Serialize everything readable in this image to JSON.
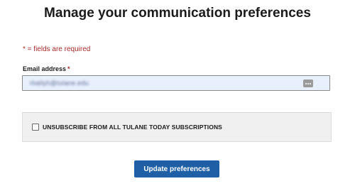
{
  "page": {
    "title": "Manage your communication preferences"
  },
  "form": {
    "required_note": "* = fields are required",
    "email": {
      "label": "Email address",
      "required_marker": "*",
      "value": "rballyh@tulane.edu",
      "value_obscured": true
    },
    "unsubscribe": {
      "label": "UNSUBSCRIBE FROM ALL TULANE TODAY SUBSCRIPTIONS",
      "checked": false
    },
    "submit_label": "Update preferences"
  },
  "colors": {
    "accent": "#1f5fa6",
    "required": "#a52a2a",
    "input_bg": "#e8f0fe",
    "panel_bg": "#f0f0f0"
  },
  "icons": {
    "autofill": "more-dots-icon"
  }
}
